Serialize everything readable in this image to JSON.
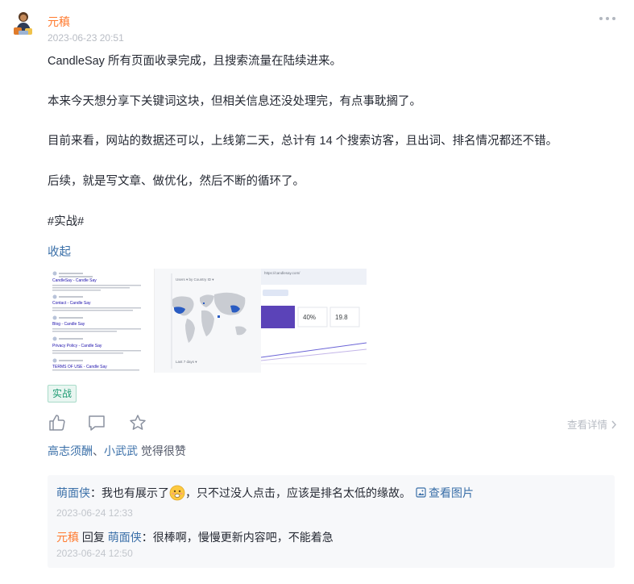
{
  "post": {
    "author": "元稹",
    "time": "2023-06-23 20:51",
    "paragraphs": [
      "CandleSay 所有页面收录完成，且搜索流量在陆续进来。",
      "本来今天想分享下关键词这块，但相关信息还没处理完，有点事耽搁了。",
      "目前来看，网站的数据还可以，上线第二天，总计有 14 个搜索访客，且出词、排名情况都还不错。",
      "后续，就是写文章、做优化，然后不断的循环了。",
      "#实战#"
    ],
    "collapse_label": "收起",
    "tag": "实战",
    "detail_label": "查看详情",
    "likes": {
      "users": [
        "高志须酬",
        "小武武"
      ],
      "separator": "、",
      "suffix": " 觉得很赞"
    }
  },
  "images": {
    "search_results": [
      {
        "title": "CandleSay - Candle Say"
      },
      {
        "title": "Contact - Candle Say"
      },
      {
        "title": "Blog - Candle Say"
      },
      {
        "title": "Privacy Policy - Candle Say"
      },
      {
        "title": "TERMS OF USE - Candle Say"
      }
    ],
    "map_header": "Users ▾ by Country ID ▾",
    "map_footer": "Last 7 days ▾",
    "url_bar": "https://candlesay.com/",
    "metric_1": "40%",
    "metric_2": "19.8"
  },
  "comments": [
    {
      "author": "萌面侠",
      "sep": "：",
      "text_before_emoji": "我也有展示了",
      "text_after_emoji": "，只不过没人点击，应该是排名太低的缘故。",
      "view_image_label": "查看图片",
      "time": "2023-06-24 12:33"
    },
    {
      "author": "元稹",
      "reply_word": " 回复 ",
      "reply_to": "萌面侠",
      "sep": "：",
      "text": "很棒啊，慢慢更新内容吧，不能着急",
      "time": "2023-06-24 12:50"
    }
  ],
  "colors": {
    "accent_orange": "#ff7a2e",
    "link_blue": "#3a6fa8",
    "tag_green": "#1e9b73",
    "muted": "#b8bcc4"
  }
}
